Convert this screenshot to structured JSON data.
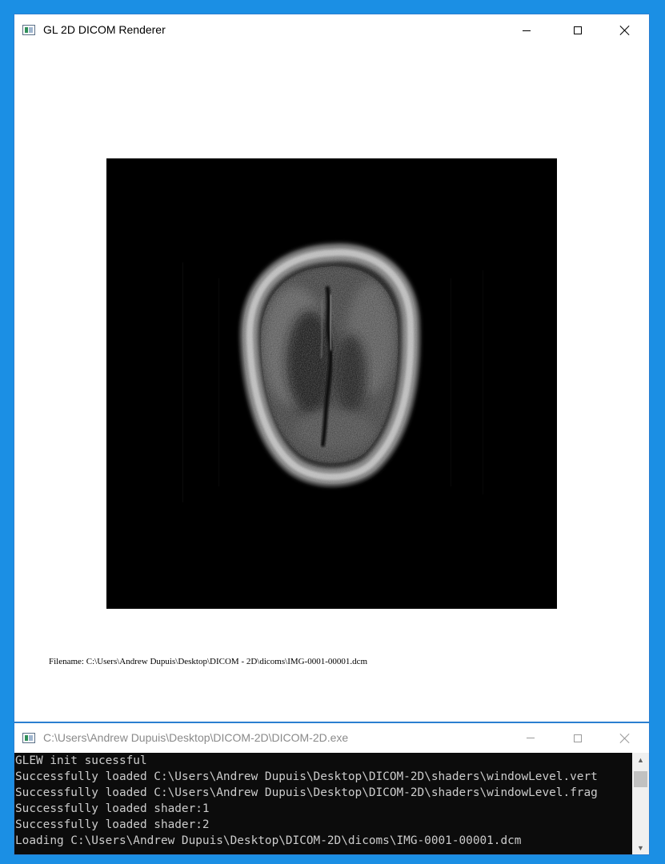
{
  "gl_window": {
    "title": "GL 2D DICOM Renderer",
    "icon": "app-window-icon",
    "filename_label": "Filename: C:\\Users\\Andrew Dupuis\\Desktop\\DICOM - 2D\\dicoms\\IMG-0001-00001.dcm",
    "viewport_content": "axial brain MRI slice"
  },
  "console_window": {
    "title": "C:\\Users\\Andrew Dupuis\\Desktop\\DICOM-2D\\DICOM-2D.exe",
    "icon": "console-window-icon",
    "lines": [
      "GLEW init sucessful",
      "Successfully loaded C:\\Users\\Andrew Dupuis\\Desktop\\DICOM-2D\\shaders\\windowLevel.vert",
      "Successfully loaded C:\\Users\\Andrew Dupuis\\Desktop\\DICOM-2D\\shaders\\windowLevel.frag",
      "Successfully loaded shader:1",
      "Successfully loaded shader:2",
      "Loading C:\\Users\\Andrew Dupuis\\Desktop\\DICOM-2D\\dicoms\\IMG-0001-00001.dcm"
    ]
  },
  "colors": {
    "desktop": "#1b8fe4",
    "console_bg": "#0c0c0c",
    "console_text": "#cccccc",
    "viewport_bg": "#000000"
  }
}
